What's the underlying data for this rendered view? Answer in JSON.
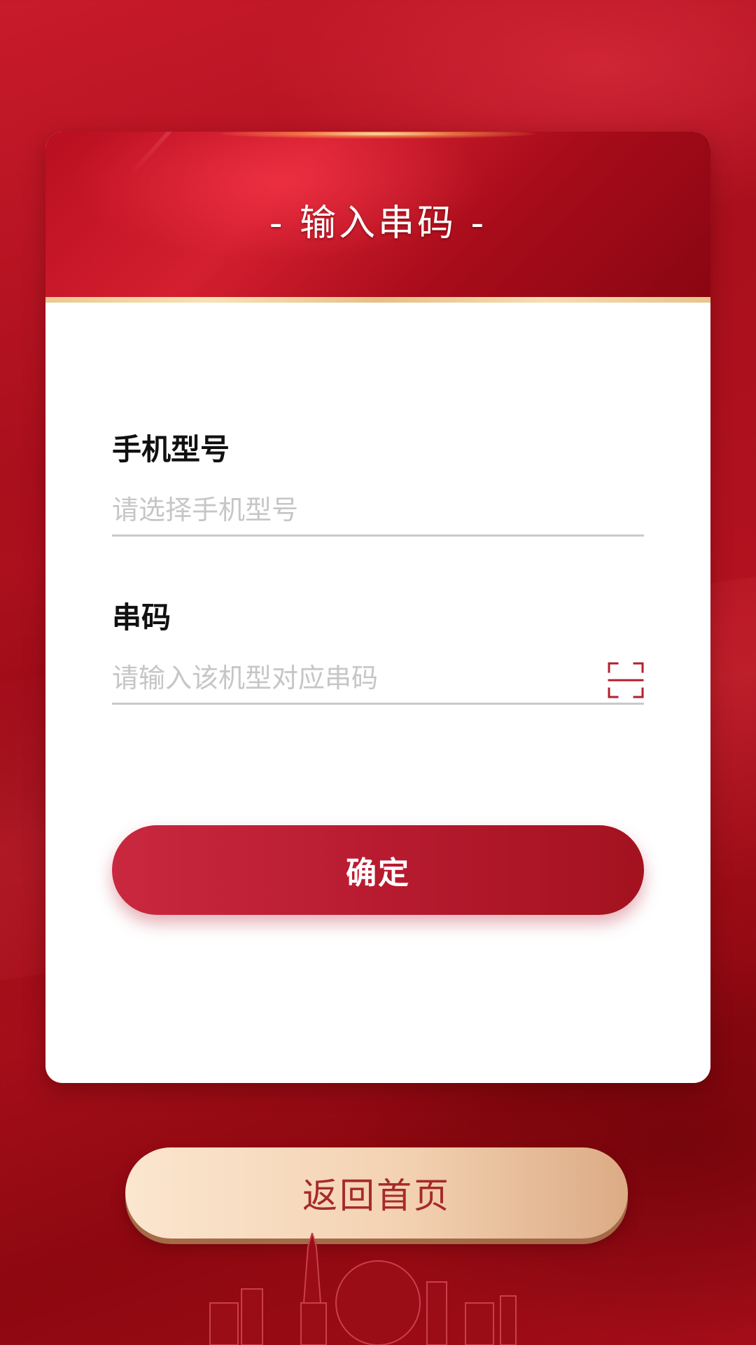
{
  "header": {
    "title": "- 输入串码 -"
  },
  "form": {
    "model": {
      "label": "手机型号",
      "placeholder": "请选择手机型号",
      "value": ""
    },
    "serial": {
      "label": "串码",
      "placeholder": "请输入该机型对应串码",
      "value": ""
    },
    "confirm_label": "确定"
  },
  "footer": {
    "home_label": "返回首页"
  },
  "icons": {
    "scan": "scan-icon"
  },
  "colors": {
    "primary_red": "#b81b30",
    "gold": "#f3d2b2",
    "home_text": "#a62a2a"
  }
}
